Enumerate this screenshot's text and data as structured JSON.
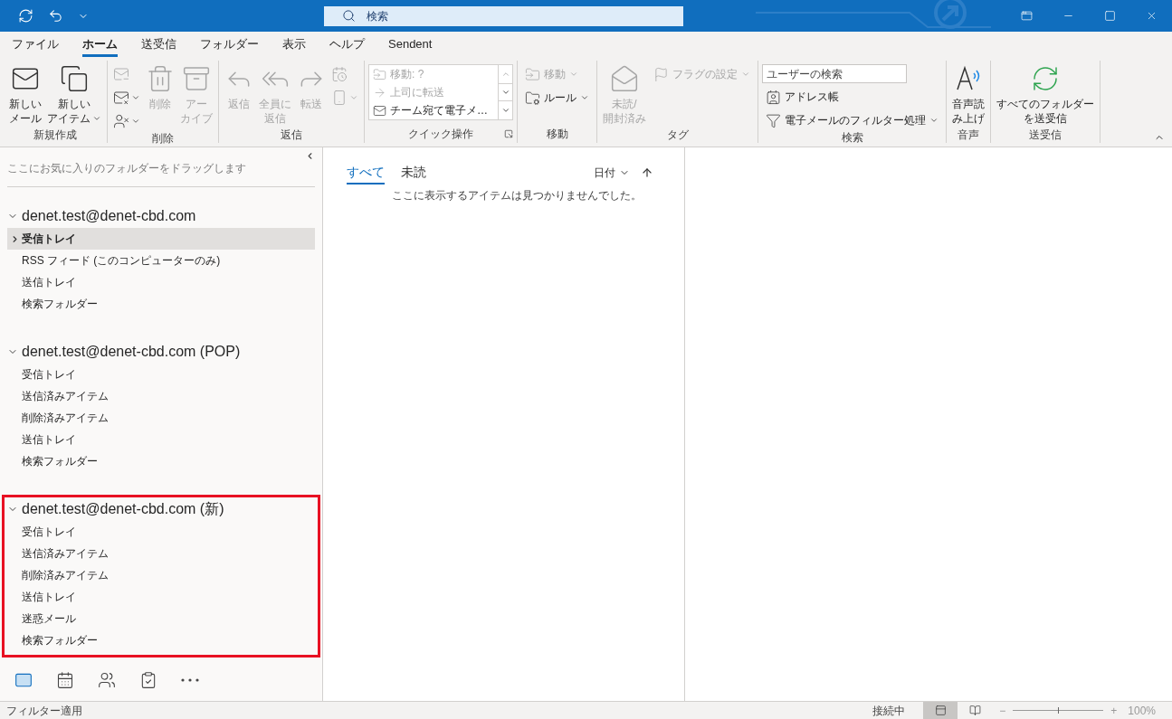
{
  "title_bar": {
    "search": {
      "placeholder": "検索"
    }
  },
  "menu_tabs": [
    {
      "label": "ファイル",
      "selected": false
    },
    {
      "label": "ホーム",
      "selected": true
    },
    {
      "label": "送受信",
      "selected": false
    },
    {
      "label": "フォルダー",
      "selected": false
    },
    {
      "label": "表示",
      "selected": false
    },
    {
      "label": "ヘルプ",
      "selected": false
    },
    {
      "label": "Sendent",
      "selected": false
    }
  ],
  "ribbon": {
    "groups": [
      {
        "label": "新規作成",
        "items": [
          {
            "kind": "large",
            "lines": [
              "新しい",
              "メール"
            ],
            "disabled": false,
            "dropdown": false
          },
          {
            "kind": "large",
            "lines": [
              "新しい",
              "アイテム"
            ],
            "disabled": false,
            "dropdown": true
          }
        ]
      },
      {
        "label": "削除",
        "items": [
          {
            "kind": "column",
            "items": [
              {
                "kind": "icon",
                "disabled": true,
                "dropdown": false
              },
              {
                "kind": "icon",
                "disabled": false,
                "dropdown": true
              },
              {
                "kind": "icon",
                "disabled": false,
                "dropdown": true
              }
            ]
          },
          {
            "kind": "large",
            "lines": [
              "削除"
            ],
            "disabled": true,
            "dropdown": false
          },
          {
            "kind": "large",
            "lines": [
              "アー",
              "カイブ"
            ],
            "disabled": true,
            "dropdown": false
          }
        ]
      },
      {
        "label": "返信",
        "items": [
          {
            "kind": "large",
            "lines": [
              "返信"
            ],
            "disabled": true,
            "dropdown": false
          },
          {
            "kind": "large",
            "lines": [
              "全員に",
              "返信"
            ],
            "disabled": true,
            "dropdown": false
          },
          {
            "kind": "large",
            "lines": [
              "転送"
            ],
            "disabled": true,
            "dropdown": false
          },
          {
            "kind": "column",
            "items": [
              {
                "kind": "icon",
                "disabled": true,
                "dropdown": false
              },
              {
                "kind": "icon",
                "disabled": true,
                "dropdown": true
              }
            ]
          }
        ]
      },
      {
        "label": "クイック操作",
        "launcher": true,
        "items": [
          {
            "kind": "quicklist",
            "entries": [
              {
                "label": "移動: ?",
                "disabled": true
              },
              {
                "label": "上司に転送",
                "disabled": true
              },
              {
                "label": "チーム宛て電子メ…",
                "disabled": false
              }
            ]
          }
        ]
      },
      {
        "label": "移動",
        "items": [
          {
            "kind": "column",
            "items": [
              {
                "kind": "small",
                "label": "移動",
                "disabled": true,
                "dropdown": true
              },
              {
                "kind": "small",
                "label": "ルール",
                "disabled": false,
                "dropdown": true
              }
            ]
          }
        ]
      },
      {
        "label": "タグ",
        "items": [
          {
            "kind": "large",
            "lines": [
              "未読/",
              "開封済み"
            ],
            "disabled": true,
            "dropdown": false
          },
          {
            "kind": "column",
            "items": [
              {
                "kind": "small",
                "label": "フラグの設定",
                "disabled": true,
                "dropdown": true
              }
            ]
          }
        ]
      },
      {
        "label": "検索",
        "items": [
          {
            "kind": "column",
            "items": [
              {
                "kind": "field",
                "placeholder": "ユーザーの検索"
              },
              {
                "kind": "small",
                "label": "アドレス帳",
                "disabled": false,
                "dropdown": false
              },
              {
                "kind": "small",
                "label": "電子メールのフィルター処理",
                "disabled": false,
                "dropdown": true
              }
            ]
          }
        ]
      },
      {
        "label": "音声",
        "items": [
          {
            "kind": "large",
            "lines": [
              "音声読",
              "み上げ"
            ],
            "disabled": false,
            "dropdown": false
          }
        ]
      },
      {
        "label": "送受信",
        "items": [
          {
            "kind": "large",
            "lines": [
              "すべてのフォルダー",
              "を送受信"
            ],
            "disabled": false,
            "dropdown": false
          }
        ]
      }
    ]
  },
  "folder_pane": {
    "favorites_hint": "ここにお気に入りのフォルダーをドラッグします",
    "accounts": [
      {
        "name": "denet.test@denet-cbd.com",
        "expanded": true,
        "highlighted": false,
        "folders": [
          {
            "name": "受信トレイ",
            "selected": true,
            "expandable": true
          },
          {
            "name": "RSS フィード (このコンピューターのみ)",
            "selected": false,
            "expandable": false
          },
          {
            "name": "送信トレイ",
            "selected": false,
            "expandable": false
          },
          {
            "name": "検索フォルダー",
            "selected": false,
            "expandable": false
          }
        ]
      },
      {
        "name": "denet.test@denet-cbd.com (POP)",
        "expanded": true,
        "highlighted": false,
        "folders": [
          {
            "name": "受信トレイ",
            "selected": false,
            "expandable": false
          },
          {
            "name": "送信済みアイテム",
            "selected": false,
            "expandable": false
          },
          {
            "name": "削除済みアイテム",
            "selected": false,
            "expandable": false
          },
          {
            "name": "送信トレイ",
            "selected": false,
            "expandable": false
          },
          {
            "name": "検索フォルダー",
            "selected": false,
            "expandable": false
          }
        ]
      },
      {
        "name": "denet.test@denet-cbd.com (新)",
        "expanded": true,
        "highlighted": true,
        "folders": [
          {
            "name": "受信トレイ",
            "selected": false,
            "expandable": false
          },
          {
            "name": "送信済みアイテム",
            "selected": false,
            "expandable": false
          },
          {
            "name": "削除済みアイテム",
            "selected": false,
            "expandable": false
          },
          {
            "name": "送信トレイ",
            "selected": false,
            "expandable": false
          },
          {
            "name": "迷惑メール",
            "selected": false,
            "expandable": false
          },
          {
            "name": "検索フォルダー",
            "selected": false,
            "expandable": false
          }
        ]
      }
    ],
    "nav": [
      {
        "selected": true
      },
      {
        "selected": false
      },
      {
        "selected": false
      },
      {
        "selected": false
      },
      {
        "selected": false
      }
    ]
  },
  "message_list": {
    "filters": [
      {
        "label": "すべて",
        "selected": true
      },
      {
        "label": "未読",
        "selected": false
      }
    ],
    "sort": "日付",
    "empty_message": "ここに表示するアイテムは見つかりませんでした。"
  },
  "status_bar": {
    "left": "フィルター適用",
    "connection": "接続中",
    "views": [
      {
        "selected": true
      },
      {
        "selected": false
      }
    ],
    "zoom_minus": "−",
    "zoom_plus": "+",
    "zoom": {
      "level": 0.5
    },
    "zoom_reading": "100%"
  }
}
